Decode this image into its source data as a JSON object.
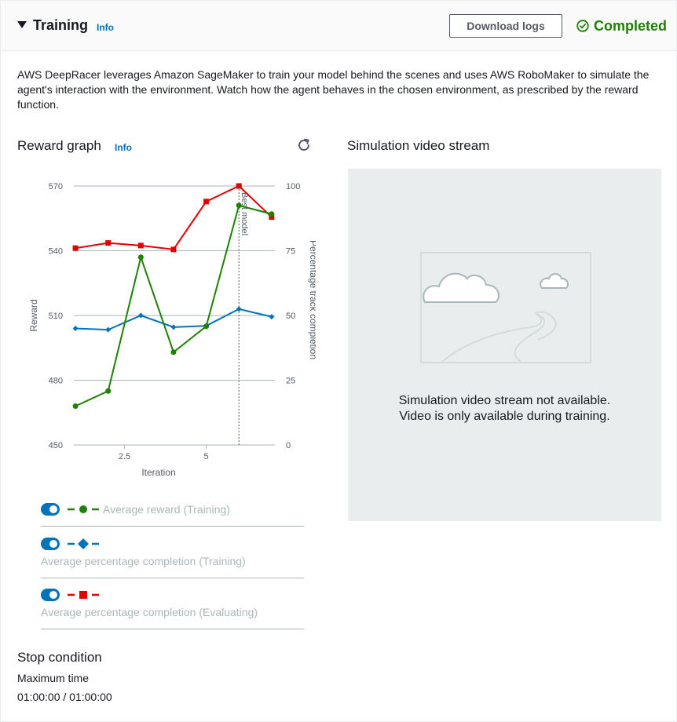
{
  "header": {
    "title": "Training",
    "info_label": "Info",
    "download_label": "Download logs",
    "status_label": "Completed",
    "status_color": "#1d8102"
  },
  "description": "AWS DeepRacer leverages Amazon SageMaker to train your model behind the scenes and uses AWS RoboMaker to simulate the agent's interaction with the environment. Watch how the agent behaves in the chosen environment, as prescribed by the reward function.",
  "reward_graph": {
    "title": "Reward graph",
    "info_label": "Info"
  },
  "legend": [
    {
      "label": "Average reward (Training)",
      "color": "#1d8102",
      "marker": "circle"
    },
    {
      "label": "Average percentage completion (Training)",
      "color": "#0073bb",
      "marker": "diamond"
    },
    {
      "label": "Average percentage completion (Evaluating)",
      "color": "#e00000",
      "marker": "square"
    }
  ],
  "simulation": {
    "title": "Simulation video stream",
    "message_line1": "Simulation video stream not available.",
    "message_line2": "Video is only available during training."
  },
  "stop_condition": {
    "title": "Stop condition",
    "label": "Maximum time",
    "value": "01:00:00 / 01:00:00"
  },
  "chart_data": {
    "type": "line",
    "xlabel": "Iteration",
    "ylabel": "Reward",
    "y2label": "Percentage track completion",
    "xlim": [
      0.95,
      7.1
    ],
    "ylim": [
      450,
      570
    ],
    "y2lim": [
      0,
      100
    ],
    "x_ticks": [
      "2.5",
      "5"
    ],
    "x_tick_values": [
      2.5,
      5
    ],
    "y_ticks": [
      "570",
      "540",
      "510",
      "480",
      "450"
    ],
    "y2_ticks": [
      "100",
      "75",
      "50",
      "25",
      "0"
    ],
    "grid": true,
    "annotation": {
      "label": "Best model",
      "x": 6
    },
    "x": [
      1,
      2,
      3,
      4,
      5,
      6,
      7
    ],
    "series": [
      {
        "name": "Average reward (Training)",
        "axis": "left",
        "color": "#1d8102",
        "marker": "circle",
        "values": [
          468,
          475,
          537,
          493,
          505,
          561,
          557
        ]
      },
      {
        "name": "Average percentage completion (Training)",
        "axis": "right",
        "color": "#0073bb",
        "marker": "diamond",
        "values": [
          45,
          44.5,
          50,
          45.5,
          46,
          52.5,
          49.5
        ]
      },
      {
        "name": "Average percentage completion (Evaluating)",
        "axis": "right",
        "color": "#e00000",
        "marker": "square",
        "values": [
          76,
          78,
          77,
          75.5,
          94,
          100,
          88
        ]
      }
    ]
  }
}
